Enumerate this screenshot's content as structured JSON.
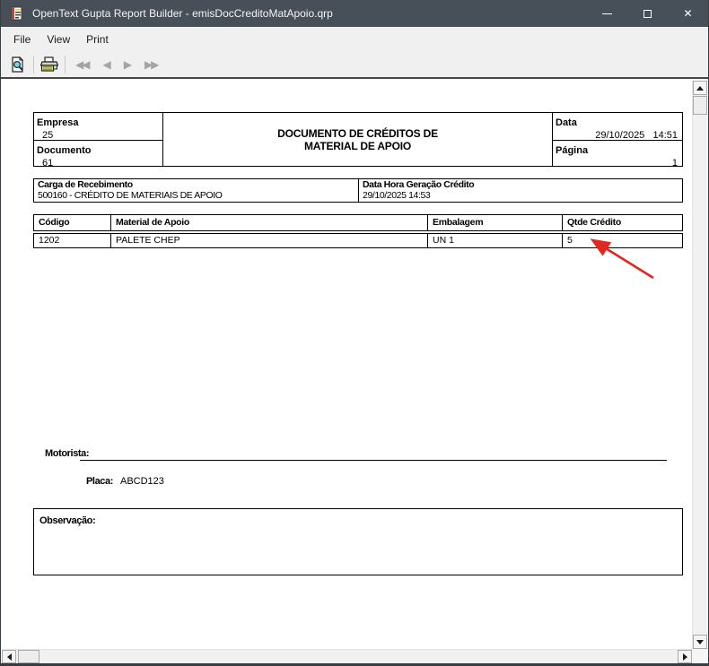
{
  "window": {
    "title": "OpenText Gupta Report Builder - emisDocCreditoMatApoio.qrp"
  },
  "menu": {
    "items": [
      {
        "label": "File"
      },
      {
        "label": "View"
      },
      {
        "label": "Print"
      }
    ]
  },
  "toolbar": {
    "nav": [
      {
        "name": "nav-first",
        "glyph": "◀◀"
      },
      {
        "name": "nav-prev",
        "glyph": "◀"
      },
      {
        "name": "nav-next",
        "glyph": "▶"
      },
      {
        "name": "nav-last",
        "glyph": "▶▶"
      }
    ]
  },
  "icons": {
    "app-icon": "report-document",
    "print-preview-icon": "page-with-magnifier",
    "print-icon": "printer",
    "minimize-icon": "—",
    "maximize-icon": "□",
    "close-icon": "✕",
    "scroll-up-icon": "▲",
    "scroll-down-icon": "▼",
    "scroll-left-icon": "◀",
    "scroll-right-icon": "▶",
    "annotation-arrow-icon": "red-arrow"
  },
  "colors": {
    "titlebar_bg": "#475058",
    "chrome_bg": "#f0f0f0",
    "annotation_red": "#e42620",
    "border": "#000000"
  },
  "report": {
    "header": {
      "empresa_label": "Empresa",
      "empresa_value": "25",
      "documento_label": "Documento",
      "documento_value": "61",
      "title_line1": "DOCUMENTO DE CRÉDITOS DE",
      "title_line2": "MATERIAL DE APOIO",
      "data_label": "Data",
      "data_value": "29/10/2025   14:51",
      "pagina_label": "Página",
      "pagina_value": "1"
    },
    "carga": {
      "label": "Carga de Recebimento",
      "value": "500160 - CRÉDITO DE MATERIAIS DE APOIO",
      "datahora_label": "Data Hora Geração Crédito",
      "datahora_value": "29/10/2025 14:53"
    },
    "table": {
      "headers": [
        "Código",
        "Material de Apoio",
        "Embalagem",
        "Qtde Crédito"
      ],
      "rows": [
        [
          "1202",
          "PALETE CHEP",
          "UN 1",
          "5"
        ]
      ]
    },
    "motorista_label": "Motorista:",
    "placa_label": "Placa:",
    "placa_value": "ABCD123",
    "observacao_label": "Observação:"
  }
}
